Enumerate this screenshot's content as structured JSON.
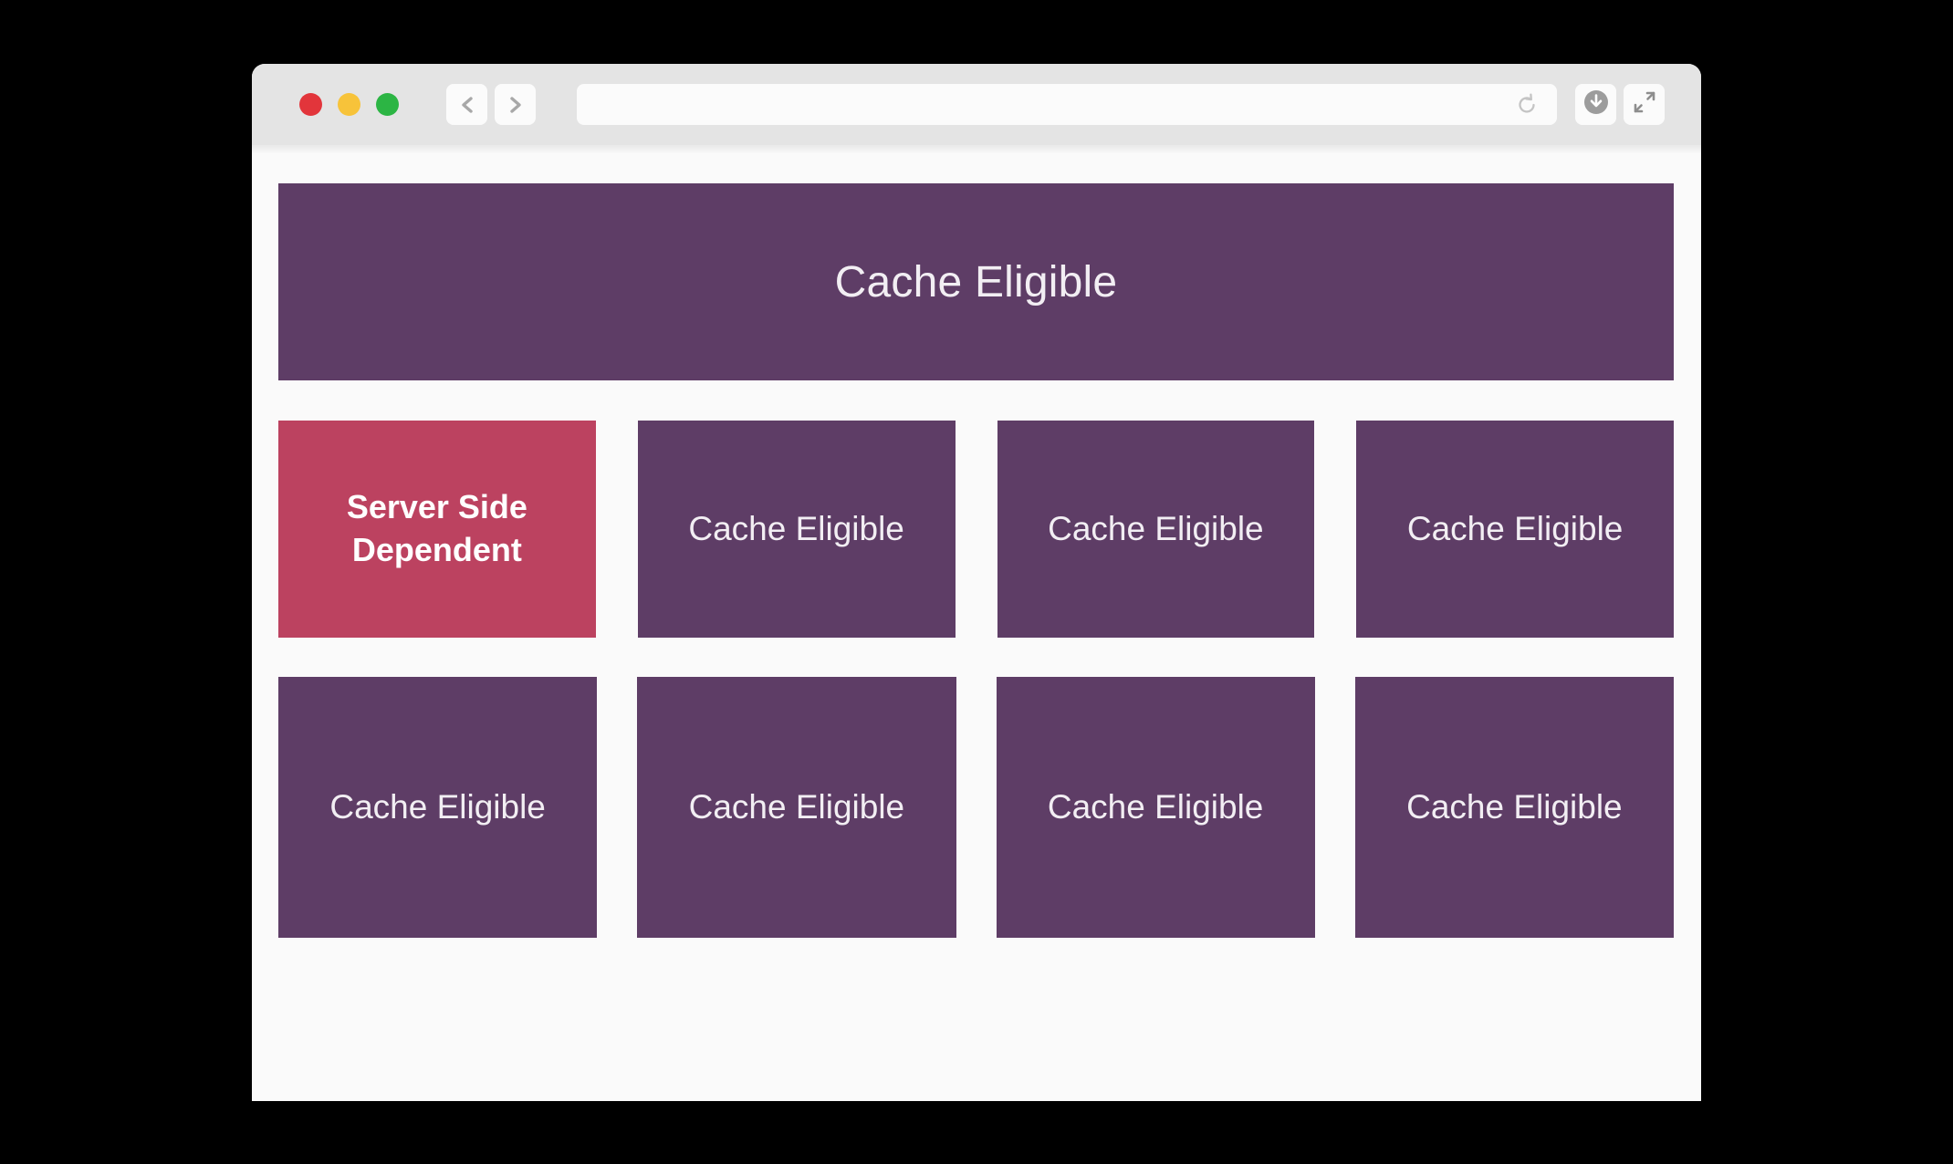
{
  "window": {
    "traffic_lights": [
      {
        "name": "close",
        "color": "#e2353b"
      },
      {
        "name": "minimize",
        "color": "#f7c33a"
      },
      {
        "name": "maximize",
        "color": "#2cb544"
      }
    ],
    "nav": {
      "back_icon": "chevron-left-icon",
      "forward_icon": "chevron-right-icon"
    },
    "address_bar": {
      "value": "",
      "placeholder": "",
      "reload_icon": "reload-icon"
    },
    "toolbar_right": [
      {
        "icon": "download-icon"
      },
      {
        "icon": "fullscreen-expand-icon"
      }
    ]
  },
  "colors": {
    "cache_eligible": "#5e3d66",
    "server_side_dependent": "#bc4260",
    "page_background": "#fafafa",
    "toolbar": "#e4e4e4",
    "card_text": "#f2eef3"
  },
  "main": {
    "hero": {
      "label": "Cache Eligible"
    },
    "rows": [
      {
        "cards": [
          {
            "label": "Server Side Dependent",
            "state": "server-side-dependent"
          },
          {
            "label": "Cache Eligible",
            "state": "cache-eligible"
          },
          {
            "label": "Cache Eligible",
            "state": "cache-eligible"
          },
          {
            "label": "Cache Eligible",
            "state": "cache-eligible"
          }
        ]
      },
      {
        "cards": [
          {
            "label": "Cache Eligible",
            "state": "cache-eligible"
          },
          {
            "label": "Cache Eligible",
            "state": "cache-eligible"
          },
          {
            "label": "Cache Eligible",
            "state": "cache-eligible"
          },
          {
            "label": "Cache Eligible",
            "state": "cache-eligible"
          }
        ]
      }
    ]
  }
}
